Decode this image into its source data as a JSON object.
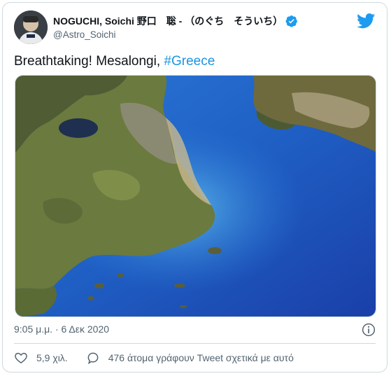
{
  "author": {
    "display_name": "NOGUCHI, Soichi 野口　聡 - （のぐち　そういち）",
    "handle": "@Astro_Soichi",
    "verified": true,
    "avatar_icon": "astronaut-avatar"
  },
  "tweet": {
    "text_prefix": "Breathtaking! Mesalongi, ",
    "hashtag": "#Greece",
    "image_description_icon": "satellite-photo"
  },
  "timestamp": "9:05 μ.μ. · 6 Δεκ 2020",
  "actions": {
    "like_count": "5,9 χιλ.",
    "reply_text": "476 άτομα γράφουν Tweet σχετικά με αυτό"
  },
  "colors": {
    "accent": "#1d9bf0",
    "hashtag": "#1b95e0",
    "secondary_text": "#536471",
    "border": "#cfd9de"
  },
  "icons": {
    "brand": "twitter-bird-icon",
    "verified": "verified-badge-icon",
    "info": "info-icon",
    "like": "heart-icon",
    "reply": "speech-bubble-icon"
  }
}
